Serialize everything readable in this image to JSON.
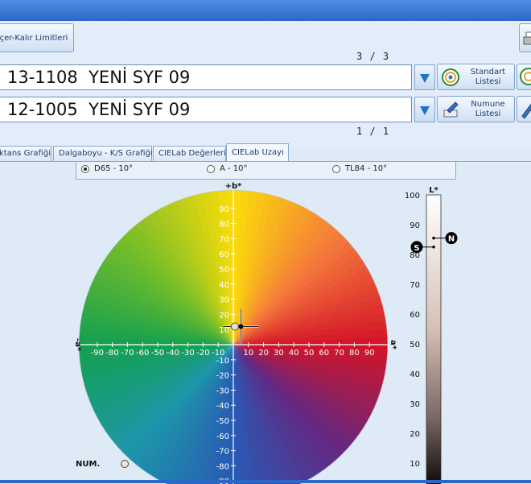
{
  "toolbar": {
    "limits_label": "çer-Kalır Limitleri",
    "standard_counter": "3 / 3",
    "sample_counter": "1 / 1",
    "standard_field": "13-1108  YENİ SYF 09",
    "sample_field": "12-1005  YENİ SYF 09",
    "standard_list_label": "Standart\nListesi",
    "sample_list_label": "Numune\nListesi"
  },
  "tabs": [
    {
      "label": "ktans Grafiği",
      "active": false
    },
    {
      "label": "Dalgaboyu - K/S Grafiği",
      "active": false
    },
    {
      "label": "CIELab Değerleri",
      "active": false
    },
    {
      "label": "CIELab Uzayı",
      "active": true
    }
  ],
  "illuminants": [
    {
      "label": "D65 - 10°",
      "selected": true
    },
    {
      "label": "A - 10°",
      "selected": false
    },
    {
      "label": "TL84 - 10°",
      "selected": false
    }
  ],
  "legend": {
    "num_label": "NUM."
  },
  "chart_data": {
    "type": "scatter",
    "title": "",
    "ab_plot": {
      "x_axis_positive": "a*",
      "x_axis_negative": "-a*",
      "y_axis_positive": "+b*",
      "xlim": [
        -100,
        100
      ],
      "ylim": [
        -100,
        100
      ],
      "x_ticks": [
        -90,
        -80,
        -70,
        -60,
        -50,
        -40,
        -30,
        -20,
        -10,
        10,
        20,
        30,
        40,
        50,
        60,
        70,
        80,
        90
      ],
      "y_ticks": [
        90,
        80,
        70,
        60,
        50,
        40,
        30,
        20,
        10,
        -10,
        -20,
        -30,
        -40,
        -50,
        -60,
        -70,
        -80,
        -90
      ],
      "points": [
        {
          "name": "standard",
          "a": 5,
          "b": 12
        },
        {
          "name": "sample",
          "a": 1,
          "b": 12
        }
      ]
    },
    "lightness_scale": {
      "label": "L*",
      "ylim": [
        0,
        100
      ],
      "ticks": [
        100,
        90,
        80,
        70,
        60,
        50,
        40,
        30,
        20,
        10
      ],
      "markers": [
        {
          "label": "S",
          "L": 82.5
        },
        {
          "label": "N",
          "L": 85.5
        }
      ]
    }
  }
}
